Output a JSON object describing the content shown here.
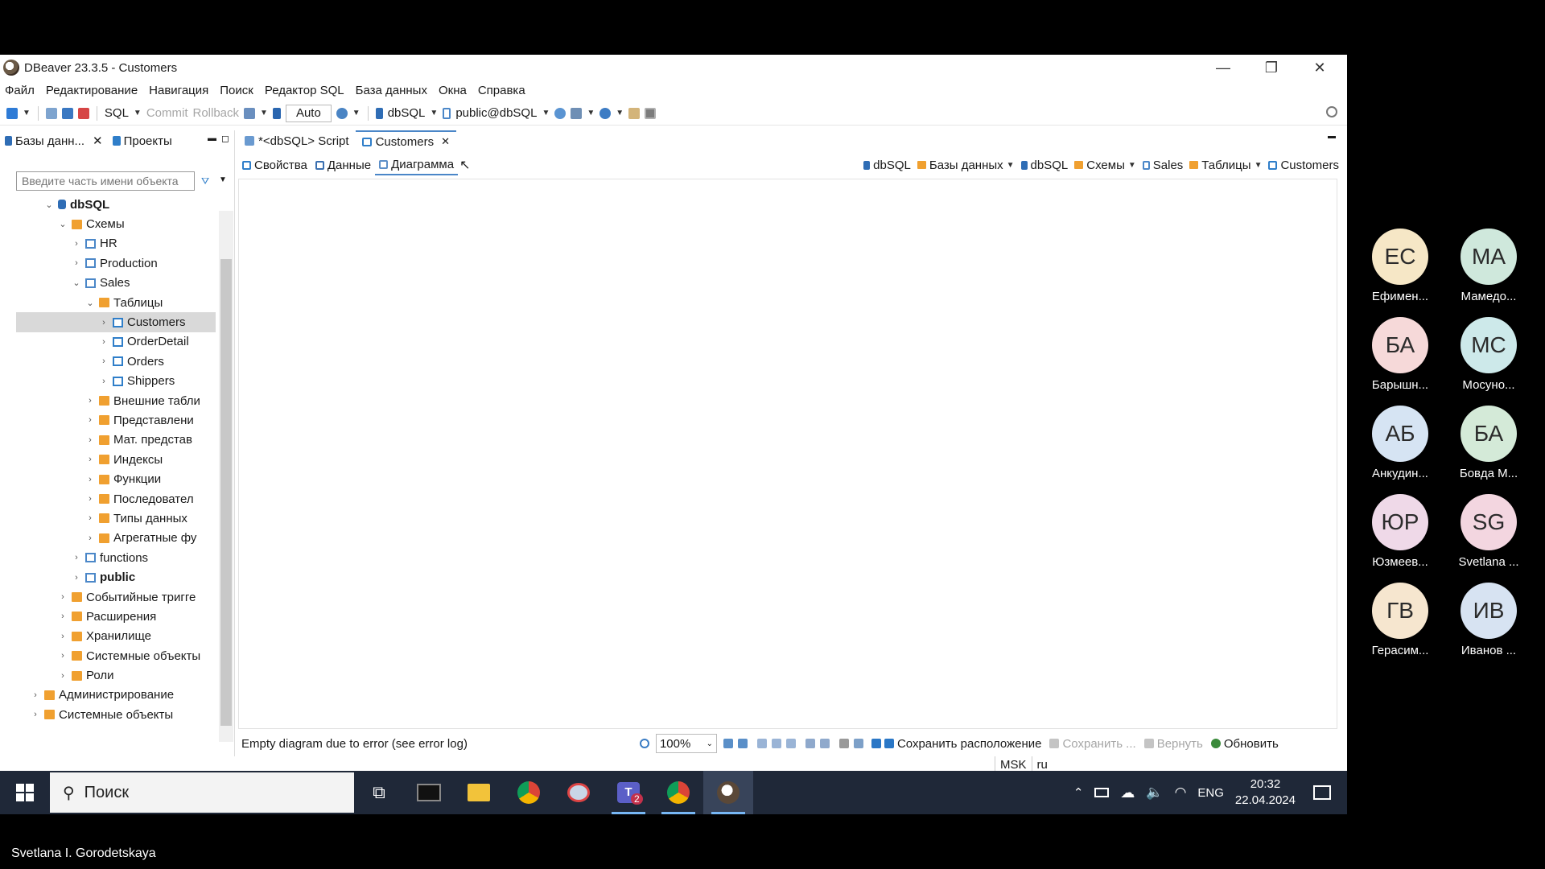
{
  "window": {
    "title": "DBeaver 23.3.5 - Customers",
    "minimize_glyph": "—",
    "restore_glyph": "❐",
    "close_glyph": "✕"
  },
  "menu": [
    "Файл",
    "Редактирование",
    "Навигация",
    "Поиск",
    "Редактор SQL",
    "База данных",
    "Окна",
    "Справка"
  ],
  "toolbar": {
    "sql": "SQL",
    "commit": "Commit",
    "rollback": "Rollback",
    "auto": "Auto",
    "datasource": "dbSQL",
    "schema": "public@dbSQL"
  },
  "navigator": {
    "tab_databases": "Базы данн...",
    "tab_projects": "Проекты",
    "filter_placeholder": "Введите часть имени объекта"
  },
  "tree": [
    {
      "label": "dbSQL",
      "depth": 2,
      "caret": "⌄",
      "icon": "db",
      "bold": true
    },
    {
      "label": "Схемы",
      "depth": 3,
      "caret": "⌄",
      "icon": "folder"
    },
    {
      "label": "HR",
      "depth": 4,
      "caret": "›",
      "icon": "schema"
    },
    {
      "label": "Production",
      "depth": 4,
      "caret": "›",
      "icon": "schema"
    },
    {
      "label": "Sales",
      "depth": 4,
      "caret": "⌄",
      "icon": "schema"
    },
    {
      "label": "Таблицы",
      "depth": 5,
      "caret": "⌄",
      "icon": "folder"
    },
    {
      "label": "Customers",
      "depth": 6,
      "caret": "›",
      "icon": "table",
      "selected": true
    },
    {
      "label": "OrderDetail",
      "depth": 6,
      "caret": "›",
      "icon": "table"
    },
    {
      "label": "Orders",
      "depth": 6,
      "caret": "›",
      "icon": "table"
    },
    {
      "label": "Shippers",
      "depth": 6,
      "caret": "›",
      "icon": "table"
    },
    {
      "label": "Внешние табли",
      "depth": 5,
      "caret": "›",
      "icon": "folder"
    },
    {
      "label": "Представлени",
      "depth": 5,
      "caret": "›",
      "icon": "folder"
    },
    {
      "label": "Мат. представ",
      "depth": 5,
      "caret": "›",
      "icon": "folder"
    },
    {
      "label": "Индексы",
      "depth": 5,
      "caret": "›",
      "icon": "folder"
    },
    {
      "label": "Функции",
      "depth": 5,
      "caret": "›",
      "icon": "folder"
    },
    {
      "label": "Последовател",
      "depth": 5,
      "caret": "›",
      "icon": "folder"
    },
    {
      "label": "Типы данных",
      "depth": 5,
      "caret": "›",
      "icon": "folder"
    },
    {
      "label": "Агрегатные фу",
      "depth": 5,
      "caret": "›",
      "icon": "folder"
    },
    {
      "label": "functions",
      "depth": 4,
      "caret": "›",
      "icon": "schema"
    },
    {
      "label": "public",
      "depth": 4,
      "caret": "›",
      "icon": "schema",
      "bold": true
    },
    {
      "label": "Событийные тригге",
      "depth": 3,
      "caret": "›",
      "icon": "folder"
    },
    {
      "label": "Расширения",
      "depth": 3,
      "caret": "›",
      "icon": "folder"
    },
    {
      "label": "Хранилище",
      "depth": 3,
      "caret": "›",
      "icon": "folder"
    },
    {
      "label": "Системные объекты",
      "depth": 3,
      "caret": "›",
      "icon": "folder"
    },
    {
      "label": "Роли",
      "depth": 3,
      "caret": "›",
      "icon": "folder"
    },
    {
      "label": "Администрирование",
      "depth": 1,
      "caret": "›",
      "icon": "folder"
    },
    {
      "label": "Системные объекты",
      "depth": 1,
      "caret": "›",
      "icon": "folder"
    }
  ],
  "editor": {
    "tab_script": "*<dbSQL> Script",
    "tab_customers": "Customers",
    "subtab_properties": "Свойства",
    "subtab_data": "Данные",
    "subtab_diagram": "Диаграмма",
    "breadcrumbs": [
      "dbSQL",
      "Базы данных",
      "dbSQL",
      "Схемы",
      "Sales",
      "Таблицы",
      "Customers"
    ]
  },
  "status": {
    "message": "Empty diagram due to error (see error log)",
    "zoom": "100%",
    "save_layout": "Сохранить расположение",
    "save": "Сохранить ...",
    "revert": "Вернуть",
    "refresh": "Обновить",
    "timezone": "MSK",
    "locale": "ru"
  },
  "taskbar": {
    "search": "Поиск",
    "lang": "ENG",
    "time": "20:32",
    "date": "22.04.2024",
    "teams_badge": "2"
  },
  "participants": [
    {
      "initials": "ЕС",
      "name": "Ефимен...",
      "color": "#f6e7c6"
    },
    {
      "initials": "МА",
      "name": "Мамедо...",
      "color": "#cfe8dc"
    },
    {
      "initials": "БА",
      "name": "Барышн...",
      "color": "#f6d9d9"
    },
    {
      "initials": "МС",
      "name": "Мосуно...",
      "color": "#cde9ea"
    },
    {
      "initials": "АБ",
      "name": "Анкудин...",
      "color": "#d6e4f3"
    },
    {
      "initials": "БА",
      "name": "Бовда М...",
      "color": "#d4ead8"
    },
    {
      "initials": "ЮР",
      "name": "Юзмеев...",
      "color": "#efd9e8"
    },
    {
      "initials": "SG",
      "name": "Svetlana ...",
      "color": "#f3d6e0"
    },
    {
      "initials": "ГВ",
      "name": "Герасим...",
      "color": "#f6e6cf"
    },
    {
      "initials": "ИВ",
      "name": "Иванов ...",
      "color": "#d7e3f2"
    }
  ],
  "presenter": "Svetlana I. Gorodetskaya"
}
